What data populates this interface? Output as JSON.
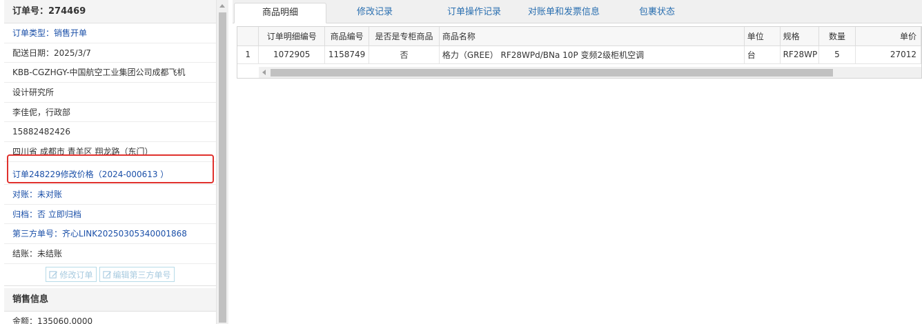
{
  "order": {
    "title": "订单号：274469",
    "type": {
      "label": "订单类型：",
      "value": "销售开单"
    },
    "delivery_date": "配送日期：2025/3/7",
    "customer_line1": "KBB-CGZHGY-中国航空工业集团公司成都飞机",
    "customer_line2": "设计研究所",
    "contact": "李佳伲，行政部",
    "phone": "15882482426",
    "address": "四川省 成都市 青羊区 翔龙路（东门）",
    "price_change_link": "订单248229修改价格（2024-000613 ）",
    "reconciliation": "对账：未对账",
    "archive": {
      "label": "归档：",
      "value": "否",
      "action": "立即归档"
    },
    "third_party": {
      "label": "第三方单号：",
      "value": "齐心LINK20250305340001868"
    },
    "settlement": "结账：未结账",
    "buttons": {
      "edit_order": "修改订单",
      "edit_third_party": "编辑第三方单号"
    }
  },
  "sales": {
    "title": "销售信息",
    "amount": "金额：135060.0000"
  },
  "tabs": [
    "商品明细",
    "修改记录",
    "订单操作记录",
    "对账单和发票信息",
    "包裹状态"
  ],
  "table": {
    "headers": [
      "",
      "订单明细编号",
      "商品编号",
      "是否是专柜商品",
      "商品名称",
      "单位",
      "规格",
      "数量",
      "单价"
    ],
    "rows": [
      [
        "1",
        "1072905",
        "1158749",
        "否",
        "格力（GREE） RF28WPd/BNa 10P 变频2级柜机空调",
        "台",
        "RF28WP",
        "5",
        "27012"
      ]
    ]
  },
  "colors": {
    "link": "#1a4fa8",
    "tab_link": "#2a6fb0",
    "highlight": "#e0302c"
  }
}
